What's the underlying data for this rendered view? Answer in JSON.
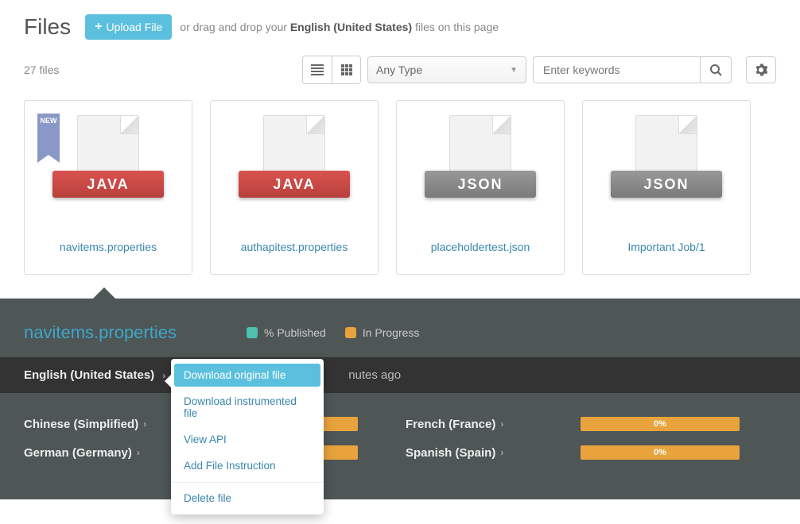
{
  "header": {
    "title": "Files",
    "upload_label": "Upload File",
    "drag_prefix": "or drag and drop your ",
    "drag_language": "English (United States)",
    "drag_suffix": " files on this page"
  },
  "toolbar": {
    "file_count": "27 files",
    "type_filter": "Any Type",
    "search_placeholder": "Enter keywords"
  },
  "files": [
    {
      "name": "navitems.properties",
      "format": "JAVA",
      "format_class": "java",
      "is_new": true
    },
    {
      "name": "authapitest.properties",
      "format": "JAVA",
      "format_class": "java",
      "is_new": false
    },
    {
      "name": "placeholdertest.json",
      "format": "JSON",
      "format_class": "json",
      "is_new": false
    },
    {
      "name": "Important Job/1",
      "format": "JSON",
      "format_class": "json",
      "is_new": false
    }
  ],
  "detail": {
    "title": "navitems.properties",
    "legend_published": "% Published",
    "legend_inprogress": "In Progress",
    "source_locale": "English (United States)",
    "updated_suffix": "nutes ago",
    "locales": [
      {
        "name": "Chinese (Simplified)",
        "percent": ""
      },
      {
        "name": "French (France)",
        "percent": "0%"
      },
      {
        "name": "German (Germany)",
        "percent": ""
      },
      {
        "name": "Spanish (Spain)",
        "percent": "0%"
      }
    ]
  },
  "menu": {
    "download_original": "Download original file",
    "download_instrumented": "Download instrumented file",
    "view_api": "View API",
    "add_instruction": "Add File Instruction",
    "delete_file": "Delete file"
  },
  "new_badge": "NEW"
}
